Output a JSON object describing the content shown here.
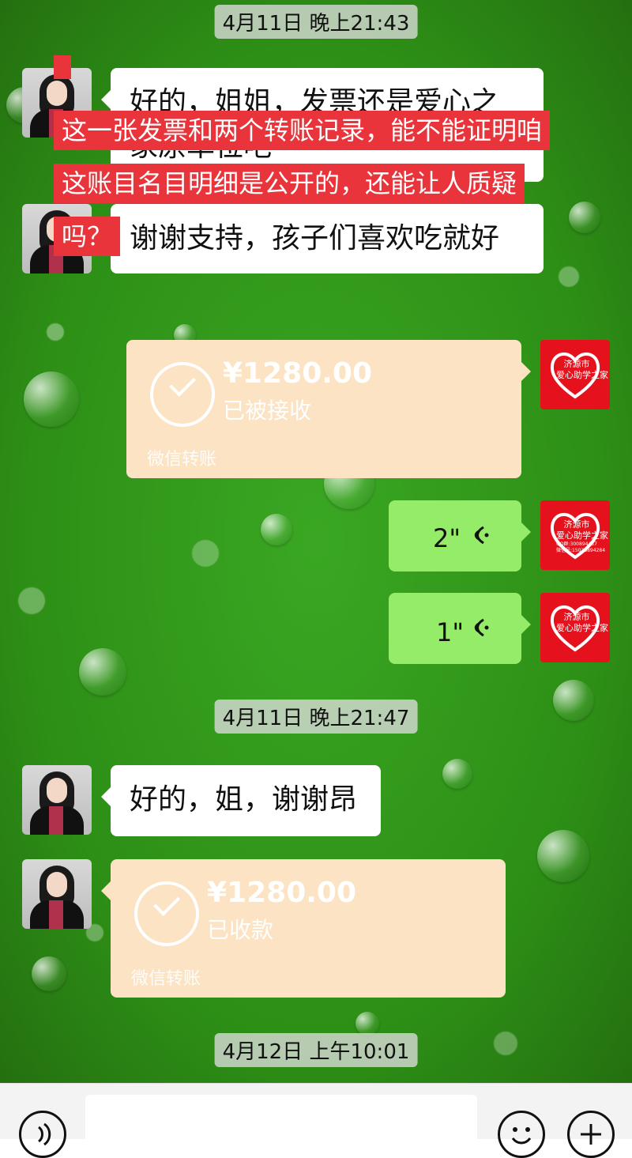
{
  "timestamps": {
    "top": "4月11日 晚上21:43",
    "mid": "4月11日 晚上21:47",
    "bottom": "4月12日 上午10:01"
  },
  "messages": {
    "m1_text": "好的，姐姐，发票还是爱心之家原单位吧",
    "m2_text": "谢谢支持，孩子们喜欢吃就好",
    "m3_text": "好的，姐，谢谢昂"
  },
  "transfer_1": {
    "amount": "¥1280.00",
    "status": "已被接收",
    "footer": "微信转账"
  },
  "transfer_2": {
    "amount": "¥1280.00",
    "status": "已收款",
    "footer": "微信转账"
  },
  "voice": {
    "v1": "2\"",
    "v2": "1\""
  },
  "overlay_caption": {
    "line1": "这一张发票和两个转账记录，能不能证明咱",
    "line2": "这账目名目明细是公开的，还能让人质疑",
    "line3": "吗？"
  },
  "logo": {
    "title1": "济源市",
    "title2": "爱心助学之家",
    "qq": "QQ群:300894437",
    "phone": "微信号:15038894284"
  },
  "icons": {
    "voice_input": "voice-input-icon",
    "emoji": "emoji-icon",
    "plus": "plus-icon"
  },
  "colors": {
    "green_bubble": "#95ec69",
    "transfer_bubble": "#fbe3c3",
    "caption_bg": "#e8343a",
    "logo_red": "#e5121d"
  }
}
